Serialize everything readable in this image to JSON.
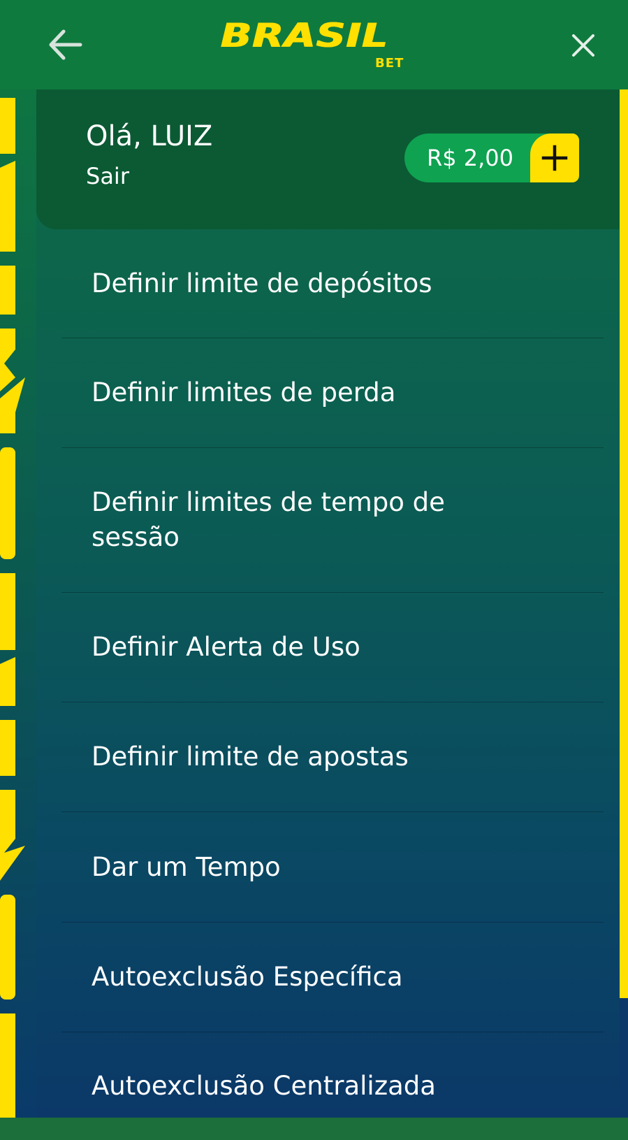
{
  "header": {
    "logo_text": "BRASIL",
    "logo_sub": "BET"
  },
  "account": {
    "greeting": "Olá, LUIZ",
    "logout_label": "Sair",
    "balance": "R$ 2,00"
  },
  "menu": {
    "items": [
      {
        "label": "Definir limite de depósitos"
      },
      {
        "label": "Definir limites de perda"
      },
      {
        "label": "Definir limites de tempo de sessão"
      },
      {
        "label": "Definir Alerta de Uso"
      },
      {
        "label": "Definir limite de apostas"
      },
      {
        "label": "Dar um Tempo"
      },
      {
        "label": "Autoexclusão Específica"
      },
      {
        "label": "Autoexclusão Centralizada"
      }
    ]
  },
  "colors": {
    "brand_yellow": "#ffe000",
    "brand_green": "#0f7a3e",
    "balance_green": "#0fa251",
    "deep_blue": "#0b3868"
  },
  "icons": {
    "back": "arrow-left-icon",
    "close": "close-icon",
    "add": "plus-icon"
  }
}
